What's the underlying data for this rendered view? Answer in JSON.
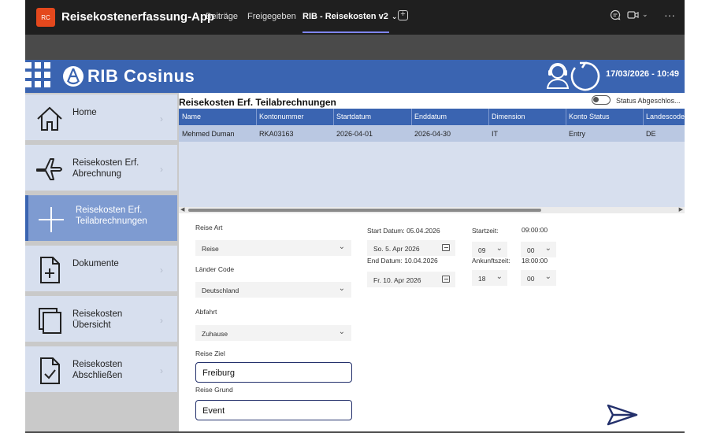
{
  "teams": {
    "app_badge": "RC",
    "app_title": "Reisekostenerfassung-App",
    "tabs": [
      "Beiträge",
      "Freigegeben",
      "RIB - Reisekosten v2"
    ],
    "active_tab_index": 2
  },
  "header": {
    "brand": "RIB Cosinus",
    "datetime": "17/03/2026 - 10:49",
    "color": "#3a64b1"
  },
  "sidebar": {
    "items": [
      {
        "label": "Home",
        "icon": "home-icon"
      },
      {
        "label": "Reisekosten Erf. Abrechnung",
        "icon": "airplane-icon"
      },
      {
        "label": "Reisekosten Erf. Teilabrechnungen",
        "icon": "plus-icon"
      },
      {
        "label": "Dokumente",
        "icon": "document-add-icon"
      },
      {
        "label": "Reisekosten Übersicht",
        "icon": "copy-icon"
      },
      {
        "label": "Reisekosten Abschließen",
        "icon": "document-check-icon"
      }
    ],
    "active_index": 2
  },
  "main": {
    "title": "Reisekosten Erf. Teilabrechnungen",
    "toggle_label": "Status Abgeschlos...",
    "toggle_on": false,
    "table": {
      "columns": [
        "Name",
        "Kontonummer",
        "Startdatum",
        "Enddatum",
        "Dimension",
        "Konto Status",
        "Landescode"
      ],
      "rows": [
        [
          "Mehmed Duman",
          "RKA03163",
          "2026-04-01",
          "2026-04-30",
          "IT",
          "Entry",
          "DE"
        ]
      ]
    }
  },
  "form": {
    "reise_art_label": "Reise Art",
    "reise_art_value": "Reise",
    "laender_code_label": "Länder Code",
    "laender_code_value": "Deutschland",
    "abfahrt_label": "Abfahrt",
    "abfahrt_value": "Zuhause",
    "reise_ziel_label": "Reise Ziel",
    "reise_ziel_value": "Freiburg",
    "reise_grund_label": "Reise Grund",
    "reise_grund_value": "Event",
    "start_datum_label": "Start Datum: 05.04.2026",
    "start_datum_value": "So. 5. Apr 2026",
    "end_datum_label": "End Datum: 10.04.2026",
    "end_datum_value": "Fr. 10. Apr 2026",
    "startzeit_label": "Startzeit:",
    "startzeit_value": "09:00:00",
    "start_hour": "09",
    "start_minute": "00",
    "ankunftszeit_label": "Ankunftszeit:",
    "ankunftszeit_value": "18:00:00",
    "end_hour": "18",
    "end_minute": "00"
  }
}
